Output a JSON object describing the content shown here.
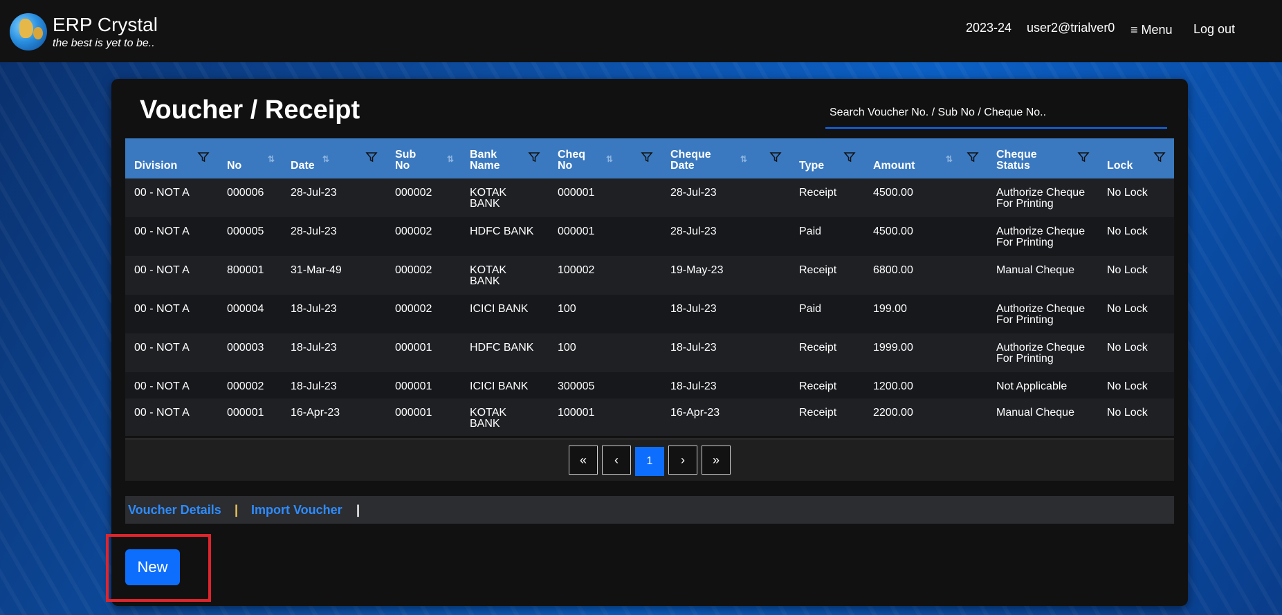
{
  "brand": {
    "title": "ERP Crystal",
    "tagline": "the best is yet to be.."
  },
  "topbar": {
    "year": "2023-24",
    "user": "user2@trialver0",
    "menu_label": "≡ Menu",
    "logout_label": "Log out"
  },
  "page": {
    "title": "Voucher / Receipt",
    "search_placeholder": "Search Voucher No. / Sub No / Cheque No.."
  },
  "table": {
    "headers": {
      "division": "Division",
      "no": "No",
      "date": "Date",
      "sub_no_1": "Sub",
      "sub_no_2": "No",
      "bank_name_1": "Bank",
      "bank_name_2": "Name",
      "cheq_no_1": "Cheq",
      "cheq_no_2": "No",
      "cheque_date_1": "Cheque",
      "cheque_date_2": "Date",
      "type": "Type",
      "amount": "Amount",
      "cheque_status_1": "Cheque",
      "cheque_status_2": "Status",
      "lock": "Lock"
    },
    "rows": [
      {
        "division": "00 - NOT A",
        "no": "000006",
        "date": "28-Jul-23",
        "sub_no": "000002",
        "bank_1": "KOTAK",
        "bank_2": "BANK",
        "cheq_no": "000001",
        "cheque_date": "28-Jul-23",
        "type": "Receipt",
        "amount": "4500.00",
        "status_1": "Authorize Cheque",
        "status_2": "For Printing",
        "lock": "No Lock"
      },
      {
        "division": "00 - NOT A",
        "no": "000005",
        "date": "28-Jul-23",
        "sub_no": "000002",
        "bank_1": "HDFC BANK",
        "bank_2": "",
        "cheq_no": "000001",
        "cheque_date": "28-Jul-23",
        "type": "Paid",
        "amount": "4500.00",
        "status_1": "Authorize Cheque",
        "status_2": "For Printing",
        "lock": "No Lock"
      },
      {
        "division": "00 - NOT A",
        "no": "800001",
        "date": "31-Mar-49",
        "sub_no": "000002",
        "bank_1": "KOTAK",
        "bank_2": "BANK",
        "cheq_no": "100002",
        "cheque_date": "19-May-23",
        "type": "Receipt",
        "amount": "6800.00",
        "status_1": "Manual Cheque",
        "status_2": "",
        "lock": "No Lock"
      },
      {
        "division": "00 - NOT A",
        "no": "000004",
        "date": "18-Jul-23",
        "sub_no": "000002",
        "bank_1": "ICICI BANK",
        "bank_2": "",
        "cheq_no": "100",
        "cheque_date": "18-Jul-23",
        "type": "Paid",
        "amount": "199.00",
        "status_1": "Authorize Cheque",
        "status_2": "For Printing",
        "lock": "No Lock"
      },
      {
        "division": "00 - NOT A",
        "no": "000003",
        "date": "18-Jul-23",
        "sub_no": "000001",
        "bank_1": "HDFC BANK",
        "bank_2": "",
        "cheq_no": "100",
        "cheque_date": "18-Jul-23",
        "type": "Receipt",
        "amount": "1999.00",
        "status_1": "Authorize Cheque",
        "status_2": "For Printing",
        "lock": "No Lock"
      },
      {
        "division": "00 - NOT A",
        "no": "000002",
        "date": "18-Jul-23",
        "sub_no": "000001",
        "bank_1": "ICICI BANK",
        "bank_2": "",
        "cheq_no": "300005",
        "cheque_date": "18-Jul-23",
        "type": "Receipt",
        "amount": "1200.00",
        "status_1": "Not Applicable",
        "status_2": "",
        "lock": "No Lock"
      },
      {
        "division": "00 - NOT A",
        "no": "000001",
        "date": "16-Apr-23",
        "sub_no": "000001",
        "bank_1": "KOTAK",
        "bank_2": "BANK",
        "cheq_no": "100001",
        "cheque_date": "16-Apr-23",
        "type": "Receipt",
        "amount": "2200.00",
        "status_1": "Manual Cheque",
        "status_2": "",
        "lock": "No Lock"
      }
    ]
  },
  "pagination": {
    "first": "«",
    "prev": "‹",
    "current": "1",
    "next": "›",
    "last": "»"
  },
  "links": {
    "voucher_details": "Voucher Details",
    "separator": "|",
    "import_voucher": "Import Voucher"
  },
  "actions": {
    "new_label": "New"
  },
  "colors": {
    "accent": "#0d6efd",
    "header_blue": "#3a79c0",
    "link_blue": "#2f8cff",
    "highlight_red": "#e0242c"
  }
}
